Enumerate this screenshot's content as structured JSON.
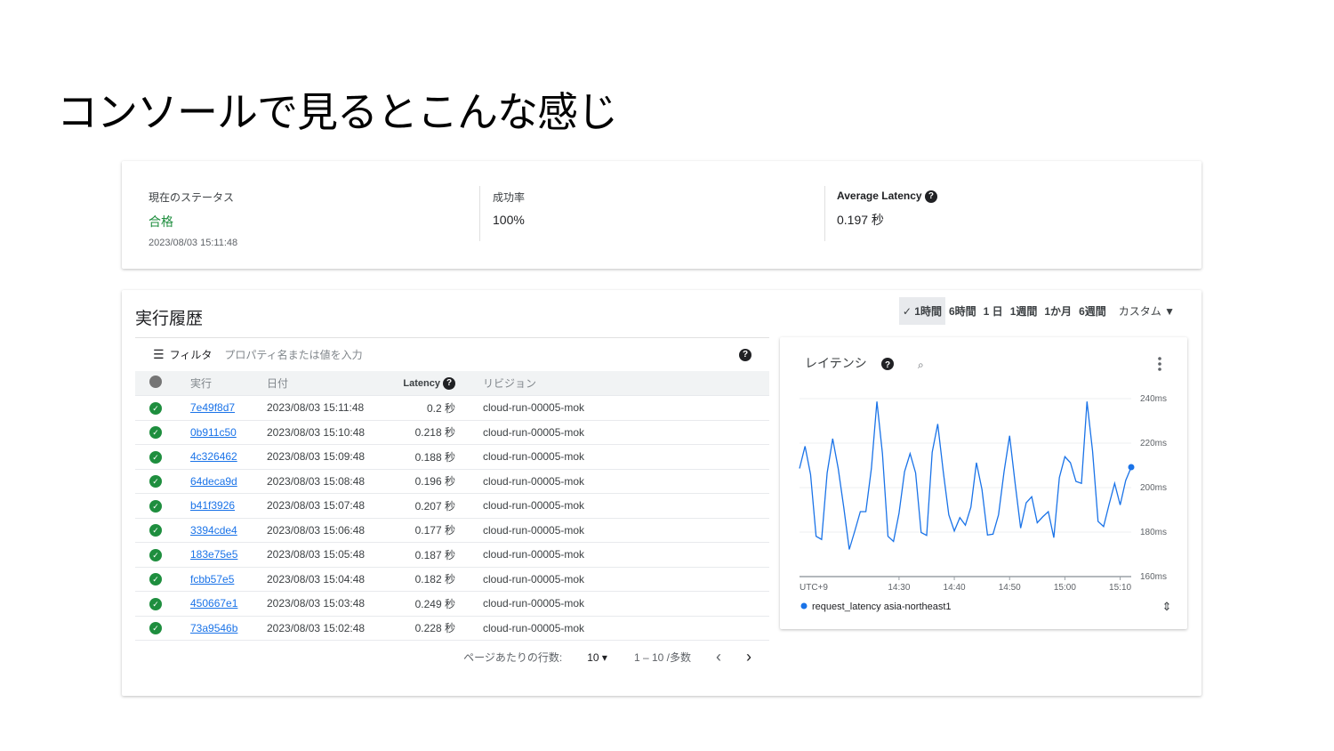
{
  "slide_title": "コンソールで見るとこんな感じ",
  "summary": {
    "status": {
      "label": "現在のステータス",
      "value": "合格",
      "time": "2023/08/03 15:11:48"
    },
    "success": {
      "label": "成功率",
      "value": "100%"
    },
    "latency": {
      "label": "Average Latency",
      "value": "0.197 秒"
    }
  },
  "history": {
    "title": "実行履歴",
    "ranges": [
      "1時間",
      "6時間",
      "1 日",
      "1週間",
      "1か月",
      "6週間"
    ],
    "custom": "カスタム",
    "filter_label": "フィルタ",
    "filter_placeholder": "プロパティ名または値を入力",
    "columns": [
      "実行",
      "日付",
      "Latency",
      "リビジョン"
    ],
    "rows": [
      {
        "id": "7e49f8d7",
        "date": "2023/08/03 15:11:48",
        "latency": "0.2 秒",
        "revision": "cloud-run-00005-mok"
      },
      {
        "id": "0b911c50",
        "date": "2023/08/03 15:10:48",
        "latency": "0.218 秒",
        "revision": "cloud-run-00005-mok"
      },
      {
        "id": "4c326462",
        "date": "2023/08/03 15:09:48",
        "latency": "0.188 秒",
        "revision": "cloud-run-00005-mok"
      },
      {
        "id": "64deca9d",
        "date": "2023/08/03 15:08:48",
        "latency": "0.196 秒",
        "revision": "cloud-run-00005-mok"
      },
      {
        "id": "b41f3926",
        "date": "2023/08/03 15:07:48",
        "latency": "0.207 秒",
        "revision": "cloud-run-00005-mok"
      },
      {
        "id": "3394cde4",
        "date": "2023/08/03 15:06:48",
        "latency": "0.177 秒",
        "revision": "cloud-run-00005-mok"
      },
      {
        "id": "183e75e5",
        "date": "2023/08/03 15:05:48",
        "latency": "0.187 秒",
        "revision": "cloud-run-00005-mok"
      },
      {
        "id": "fcbb57e5",
        "date": "2023/08/03 15:04:48",
        "latency": "0.182 秒",
        "revision": "cloud-run-00005-mok"
      },
      {
        "id": "450667e1",
        "date": "2023/08/03 15:03:48",
        "latency": "0.249 秒",
        "revision": "cloud-run-00005-mok"
      },
      {
        "id": "73a9546b",
        "date": "2023/08/03 15:02:48",
        "latency": "0.228 秒",
        "revision": "cloud-run-00005-mok"
      }
    ],
    "pager": {
      "rows_label": "ページあたりの行数:",
      "rows_value": "10",
      "range": "1 – 10 /多数"
    }
  },
  "chart_data": {
    "type": "line",
    "title": "レイテンシ",
    "timezone": "UTC+9",
    "x_start_minute": "14:12",
    "x_step_minutes": 1,
    "x_ticks": [
      "14:30",
      "14:40",
      "14:50",
      "15:00",
      "15:10"
    ],
    "y_ticks": [
      "160ms",
      "180ms",
      "200ms",
      "220ms",
      "240ms"
    ],
    "ylim": [
      160,
      240
    ],
    "series": [
      {
        "name": "request_latency asia-northeast1",
        "color": "#1a73e8",
        "values": [
          208.6,
          218.6,
          205.9,
          178.1,
          176.7,
          206.6,
          222,
          208.6,
          191.2,
          172.2,
          180.5,
          189.2,
          189.2,
          208.6,
          238.7,
          215.3,
          178.1,
          175.8,
          188.5,
          207.2,
          215.3,
          206.6,
          179.8,
          178.5,
          215.9,
          228.6,
          207.2,
          187.8,
          180.5,
          186.5,
          183.1,
          191.2,
          211.2,
          199.2,
          178.7,
          179.1,
          187.8,
          207.2,
          223.3,
          201.9,
          181.8,
          193.2,
          195.9,
          184.2,
          186.9,
          189.2,
          177.5,
          204.5,
          213.9,
          211.2,
          202.8,
          201.9,
          238.7,
          216.6,
          184.8,
          182.5,
          192.5,
          201.9,
          192.2,
          203.2,
          209.2
        ]
      }
    ]
  }
}
